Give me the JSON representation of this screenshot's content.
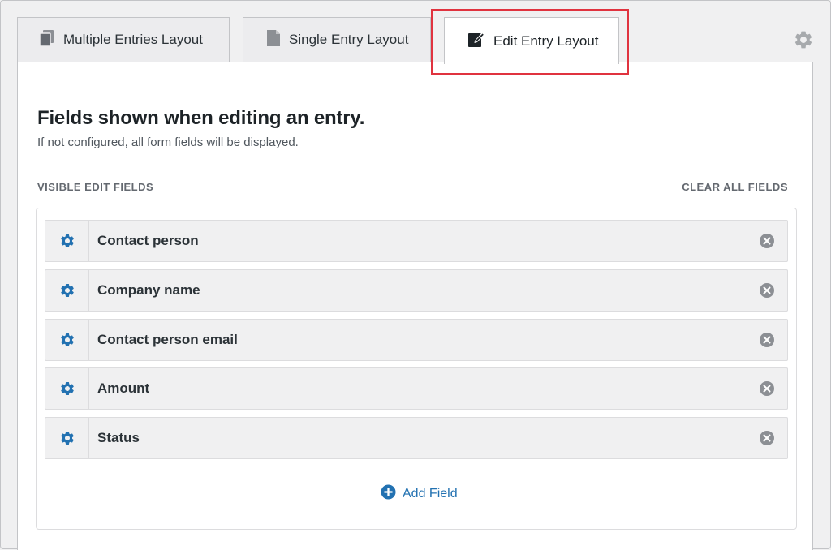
{
  "tabs": [
    {
      "label": "Multiple Entries Layout",
      "icon": "documents-icon"
    },
    {
      "label": "Single Entry Layout",
      "icon": "document-icon"
    },
    {
      "label": "Edit Entry Layout",
      "icon": "edit-icon",
      "active": true
    }
  ],
  "settings_icon": "gear-icon",
  "panel": {
    "heading": "Fields shown when editing an entry.",
    "subheading": "If not configured, all form fields will be displayed.",
    "section_label": "VISIBLE EDIT FIELDS",
    "clear_all_label": "CLEAR ALL FIELDS",
    "fields": [
      {
        "label": "Contact person"
      },
      {
        "label": "Company name"
      },
      {
        "label": "Contact person email"
      },
      {
        "label": "Amount"
      },
      {
        "label": "Status"
      }
    ],
    "add_field_label": "Add Field"
  },
  "colors": {
    "accent": "#2271b1",
    "highlight": "#e0333f",
    "remove_icon": "#8c8f94",
    "background": "#f0f0f1"
  }
}
